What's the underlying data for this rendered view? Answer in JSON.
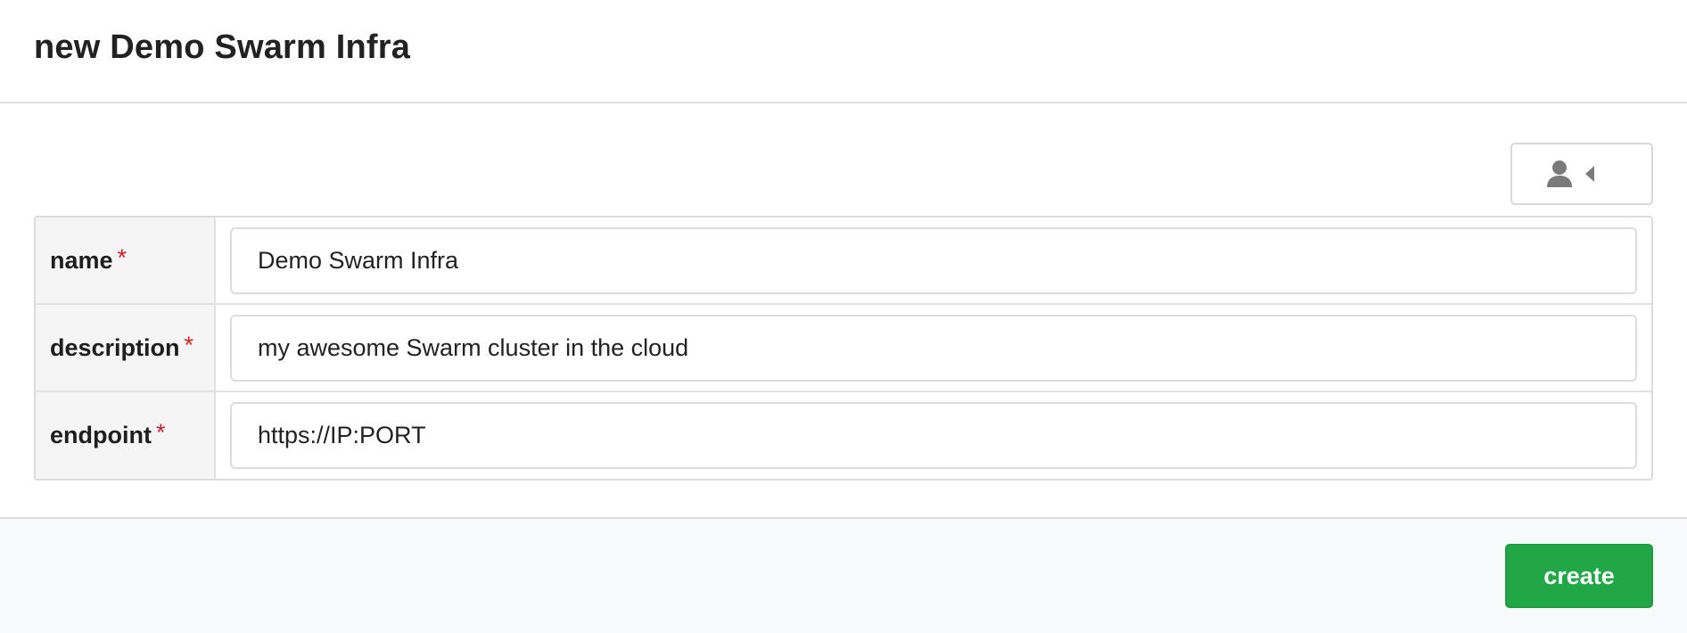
{
  "header": {
    "title": "new Demo Swarm Infra"
  },
  "owner_dropdown": {
    "icon": "user-icon",
    "caret_icon": "caret-left-icon",
    "icon_color": "#7a7a7a"
  },
  "form": {
    "required_marker": "*",
    "fields": [
      {
        "label": "name",
        "value": "Demo Swarm Infra"
      },
      {
        "label": "description",
        "value": "my awesome Swarm cluster in the cloud"
      },
      {
        "label": "endpoint",
        "value": "https://IP:PORT"
      }
    ]
  },
  "footer": {
    "create_label": "create"
  },
  "colors": {
    "accent_green": "#22a746",
    "required_red": "#d0202a",
    "footer_bg": "#f8f9fa",
    "label_bg": "#f5f5f5"
  }
}
